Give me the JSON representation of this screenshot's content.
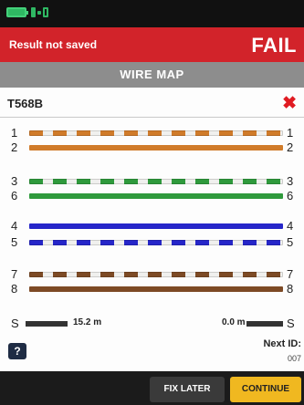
{
  "status": {
    "icons": [
      "battery-icon",
      "network-icon"
    ],
    "result_text": "Result not saved",
    "verdict": "FAIL",
    "accent_color": "#d2232a"
  },
  "section": {
    "title": "WIRE MAP"
  },
  "wiremap": {
    "standard": "T568B",
    "status_icon": "x-icon",
    "pins": {
      "p1": "1",
      "p2": "2",
      "p3": "3",
      "p6": "6",
      "p4": "4",
      "p5": "5",
      "p7": "7",
      "p8": "8"
    },
    "shield": {
      "left_label": "S",
      "left_length": "15.2 m",
      "right_length": "0.0 m",
      "right_label": "S"
    },
    "help_label": "?",
    "next_id_label": "Next ID:",
    "next_id_value": "007"
  },
  "actions": {
    "fix_later": "FIX LATER",
    "continue": "CONTINUE"
  }
}
